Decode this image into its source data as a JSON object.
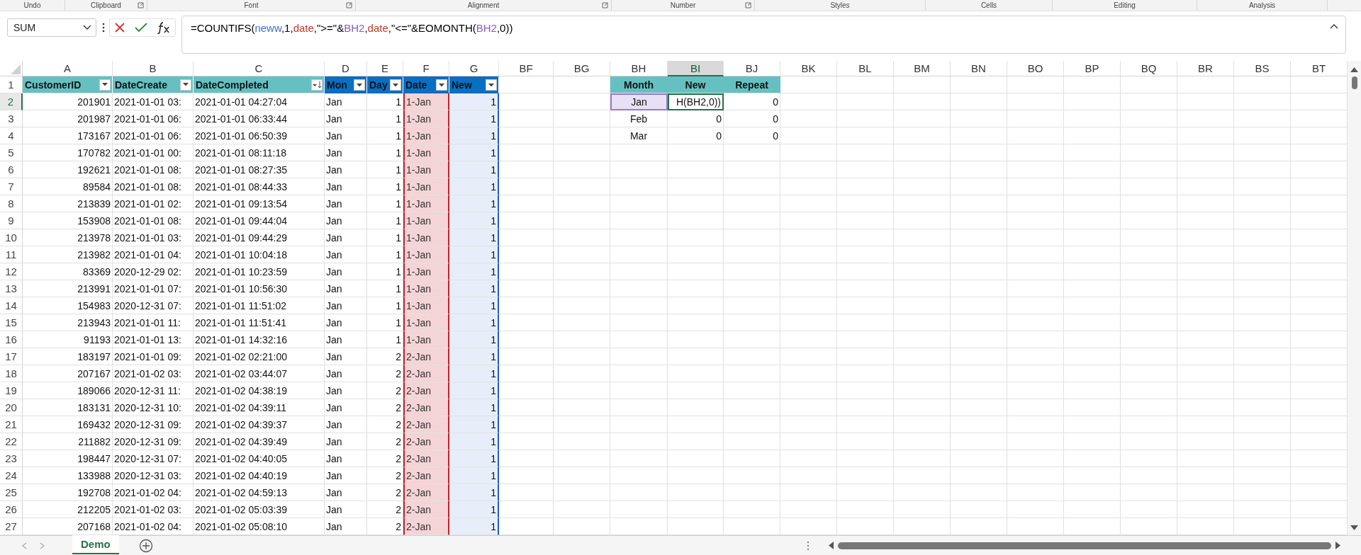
{
  "ribbon_groups": [
    {
      "label": "Undo",
      "launcher": false
    },
    {
      "label": "Clipboard",
      "launcher": true
    },
    {
      "label": "Font",
      "launcher": true
    },
    {
      "label": "Alignment",
      "launcher": true
    },
    {
      "label": "Number",
      "launcher": true
    },
    {
      "label": "Styles",
      "launcher": false
    },
    {
      "label": "Cells",
      "launcher": false
    },
    {
      "label": "Editing",
      "launcher": false
    },
    {
      "label": "Analysis",
      "launcher": false
    }
  ],
  "name_box": {
    "value": "SUM"
  },
  "formula_bar": {
    "parts": [
      {
        "text": "=COUNTIFS("
      },
      {
        "text": "neww",
        "color": "#3f6fc9"
      },
      {
        "text": ",1,"
      },
      {
        "text": "date",
        "color": "#c0392b"
      },
      {
        "text": ",\">=\"&"
      },
      {
        "text": "BH2",
        "color": "#8a5cc4"
      },
      {
        "text": ","
      },
      {
        "text": "date",
        "color": "#c0392b"
      },
      {
        "text": ",\"<=\"&EOMONTH("
      },
      {
        "text": "BH2",
        "color": "#8a5cc4"
      },
      {
        "text": ",0))"
      }
    ]
  },
  "column_letters": [
    {
      "label": "A",
      "selected": false
    },
    {
      "label": "B",
      "selected": false
    },
    {
      "label": "C",
      "selected": false
    },
    {
      "label": "D",
      "selected": false
    },
    {
      "label": "E",
      "selected": false
    },
    {
      "label": "F",
      "selected": false
    },
    {
      "label": "G",
      "selected": false
    },
    {
      "label": "BF",
      "selected": false
    },
    {
      "label": "BG",
      "selected": false
    },
    {
      "label": "BH",
      "selected": false
    },
    {
      "label": "BI",
      "selected": true
    },
    {
      "label": "BJ",
      "selected": false
    },
    {
      "label": "BK",
      "selected": false
    },
    {
      "label": "BL",
      "selected": false
    },
    {
      "label": "BM",
      "selected": false
    },
    {
      "label": "BN",
      "selected": false
    },
    {
      "label": "BO",
      "selected": false
    },
    {
      "label": "BP",
      "selected": false
    },
    {
      "label": "BQ",
      "selected": false
    },
    {
      "label": "BR",
      "selected": false
    },
    {
      "label": "BS",
      "selected": false
    },
    {
      "label": "BT",
      "selected": false
    }
  ],
  "row_numbers": [
    {
      "label": "1",
      "selected": false
    },
    {
      "label": "2",
      "selected": true
    },
    {
      "label": "3",
      "selected": false
    },
    {
      "label": "4",
      "selected": false
    },
    {
      "label": "5",
      "selected": false
    },
    {
      "label": "6",
      "selected": false
    },
    {
      "label": "7",
      "selected": false
    },
    {
      "label": "8",
      "selected": false
    },
    {
      "label": "9",
      "selected": false
    },
    {
      "label": "10",
      "selected": false
    },
    {
      "label": "11",
      "selected": false
    },
    {
      "label": "12",
      "selected": false
    },
    {
      "label": "13",
      "selected": false
    },
    {
      "label": "14",
      "selected": false
    },
    {
      "label": "15",
      "selected": false
    },
    {
      "label": "16",
      "selected": false
    },
    {
      "label": "17",
      "selected": false
    },
    {
      "label": "18",
      "selected": false
    },
    {
      "label": "19",
      "selected": false
    },
    {
      "label": "20",
      "selected": false
    },
    {
      "label": "21",
      "selected": false
    },
    {
      "label": "22",
      "selected": false
    },
    {
      "label": "23",
      "selected": false
    },
    {
      "label": "24",
      "selected": false
    },
    {
      "label": "25",
      "selected": false
    },
    {
      "label": "26",
      "selected": false
    },
    {
      "label": "27",
      "selected": false
    }
  ],
  "table": {
    "columns": [
      {
        "label": "CustomerID",
        "color": "#66c0c2",
        "kind": "filter"
      },
      {
        "label": "DateCreate",
        "color": "#66c0c2",
        "kind": "filter"
      },
      {
        "label": "DateCompleted",
        "color": "#66c0c2",
        "kind": "sorted"
      },
      {
        "label": "Mon",
        "color": "#0a6fc2",
        "kind": "filter"
      },
      {
        "label": "Day",
        "color": "#0a6fc2",
        "kind": "filter"
      },
      {
        "label": "Date",
        "color": "#0a6fc2",
        "kind": "filter"
      },
      {
        "label": "New",
        "color": "#0a6fc2",
        "kind": "filter"
      }
    ],
    "rows": [
      [
        "201901",
        "2021-01-01 03:",
        "2021-01-01 04:27:04",
        "Jan",
        "1",
        "1-Jan",
        "1"
      ],
      [
        "201987",
        "2021-01-01 06:",
        "2021-01-01 06:33:44",
        "Jan",
        "1",
        "1-Jan",
        "1"
      ],
      [
        "173167",
        "2021-01-01 06:",
        "2021-01-01 06:50:39",
        "Jan",
        "1",
        "1-Jan",
        "1"
      ],
      [
        "170782",
        "2021-01-01 00:",
        "2021-01-01 08:11:18",
        "Jan",
        "1",
        "1-Jan",
        "1"
      ],
      [
        "192621",
        "2021-01-01 08:",
        "2021-01-01 08:27:35",
        "Jan",
        "1",
        "1-Jan",
        "1"
      ],
      [
        "89584",
        "2021-01-01 08:",
        "2021-01-01 08:44:33",
        "Jan",
        "1",
        "1-Jan",
        "1"
      ],
      [
        "213839",
        "2021-01-01 02:",
        "2021-01-01 09:13:54",
        "Jan",
        "1",
        "1-Jan",
        "1"
      ],
      [
        "153908",
        "2021-01-01 08:",
        "2021-01-01 09:44:04",
        "Jan",
        "1",
        "1-Jan",
        "1"
      ],
      [
        "213978",
        "2021-01-01 03:",
        "2021-01-01 09:44:29",
        "Jan",
        "1",
        "1-Jan",
        "1"
      ],
      [
        "213982",
        "2021-01-01 04:",
        "2021-01-01 10:04:18",
        "Jan",
        "1",
        "1-Jan",
        "1"
      ],
      [
        "83369",
        "2020-12-29 02:",
        "2021-01-01 10:23:59",
        "Jan",
        "1",
        "1-Jan",
        "1"
      ],
      [
        "213991",
        "2021-01-01 07:",
        "2021-01-01 10:56:30",
        "Jan",
        "1",
        "1-Jan",
        "1"
      ],
      [
        "154983",
        "2020-12-31 07:",
        "2021-01-01 11:51:02",
        "Jan",
        "1",
        "1-Jan",
        "1"
      ],
      [
        "213943",
        "2021-01-01 11:",
        "2021-01-01 11:51:41",
        "Jan",
        "1",
        "1-Jan",
        "1"
      ],
      [
        "91193",
        "2021-01-01 13:",
        "2021-01-01 14:32:16",
        "Jan",
        "1",
        "1-Jan",
        "1"
      ],
      [
        "183197",
        "2021-01-01 09:",
        "2021-01-02 02:21:00",
        "Jan",
        "2",
        "2-Jan",
        "1"
      ],
      [
        "207167",
        "2021-01-02 03:",
        "2021-01-02 03:44:07",
        "Jan",
        "2",
        "2-Jan",
        "1"
      ],
      [
        "189066",
        "2020-12-31 11:",
        "2021-01-02 04:38:19",
        "Jan",
        "2",
        "2-Jan",
        "1"
      ],
      [
        "183131",
        "2020-12-31 10:",
        "2021-01-02 04:39:11",
        "Jan",
        "2",
        "2-Jan",
        "1"
      ],
      [
        "169432",
        "2020-12-31 09:",
        "2021-01-02 04:39:37",
        "Jan",
        "2",
        "2-Jan",
        "1"
      ],
      [
        "211882",
        "2020-12-31 09:",
        "2021-01-02 04:39:49",
        "Jan",
        "2",
        "2-Jan",
        "1"
      ],
      [
        "198447",
        "2020-12-31 07:",
        "2021-01-02 04:40:05",
        "Jan",
        "2",
        "2-Jan",
        "1"
      ],
      [
        "133988",
        "2020-12-31 03:",
        "2021-01-02 04:40:19",
        "Jan",
        "2",
        "2-Jan",
        "1"
      ],
      [
        "192708",
        "2021-01-02 04:",
        "2021-01-02 04:59:13",
        "Jan",
        "2",
        "2-Jan",
        "1"
      ],
      [
        "212205",
        "2021-01-02 03:",
        "2021-01-02 05:03:39",
        "Jan",
        "2",
        "2-Jan",
        "1"
      ],
      [
        "207168",
        "2021-01-02 04:",
        "2021-01-02 05:08:10",
        "Jan",
        "2",
        "2-Jan",
        "1"
      ]
    ]
  },
  "summary": {
    "headers": [
      "Month",
      "New",
      "Repeat"
    ],
    "rows": [
      [
        {
          "text": "Jan",
          "kind": "reference"
        },
        {
          "text": "H(BH2,0))",
          "kind": "editing"
        },
        {
          "text": "0",
          "kind": "plain"
        }
      ],
      [
        {
          "text": "Feb",
          "kind": "plain"
        },
        {
          "text": "0",
          "kind": "plain"
        },
        {
          "text": "0",
          "kind": "plain"
        }
      ],
      [
        {
          "text": "Mar",
          "kind": "plain"
        },
        {
          "text": "0",
          "kind": "plain"
        },
        {
          "text": "0",
          "kind": "plain"
        }
      ]
    ]
  },
  "sheet_tabs": [
    {
      "label": "Demo",
      "selected": true
    }
  ]
}
